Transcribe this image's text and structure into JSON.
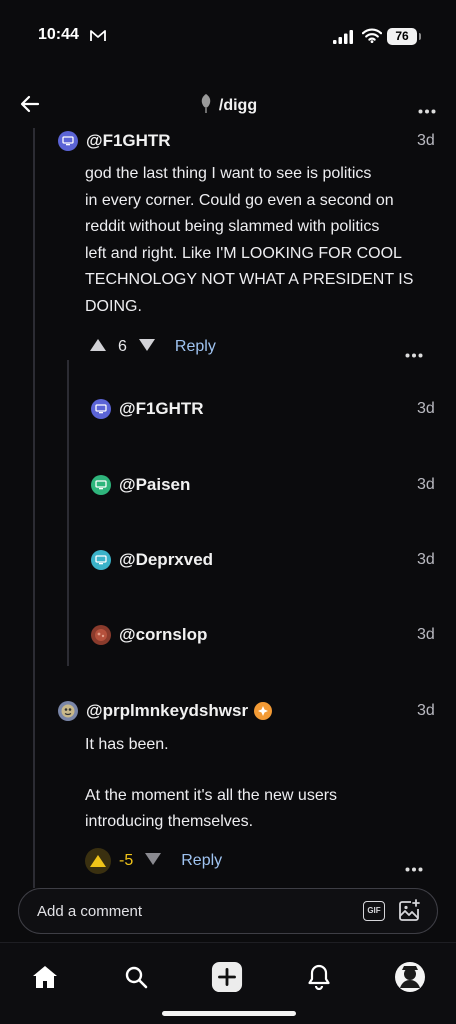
{
  "status_bar": {
    "time": "10:44",
    "battery": "76"
  },
  "nav": {
    "community": "/digg"
  },
  "thread": {
    "parent": {
      "username": "@F1GHTR",
      "time": "3d",
      "body_lines": [
        "god the last thing I want to see is politics",
        "in every corner. Could go even a second on",
        "reddit without being slammed with politics",
        "left and right. Like I'M LOOKING FOR COOL",
        "TECHNOLOGY NOT WHAT A PRESIDENT IS",
        "DOING."
      ],
      "votes": "6",
      "reply_label": "Reply"
    },
    "replies": [
      {
        "username": "@F1GHTR",
        "time": "3d",
        "avatar_color": "#5b64d6"
      },
      {
        "username": "@Paisen",
        "time": "3d",
        "avatar_color": "#2fb57c"
      },
      {
        "username": "@Deprxved",
        "time": "3d",
        "avatar_color": "#3bb3c9"
      },
      {
        "username": "@cornslop",
        "time": "3d",
        "avatar_color": "#8a3b2c"
      }
    ],
    "second": {
      "username": "@prplmnkeydshwsr",
      "time": "3d",
      "body_lines": [
        "It has been.",
        "",
        "At the moment it's all the new users",
        "introducing themselves."
      ],
      "votes": "-5",
      "reply_label": "Reply"
    }
  },
  "composer": {
    "placeholder": "Add a comment",
    "gif_label": "GIF"
  },
  "colors": {
    "accent_blue": "#9fc3f0",
    "upvote_active": "#f0c419",
    "background": "#0b0b0d"
  }
}
